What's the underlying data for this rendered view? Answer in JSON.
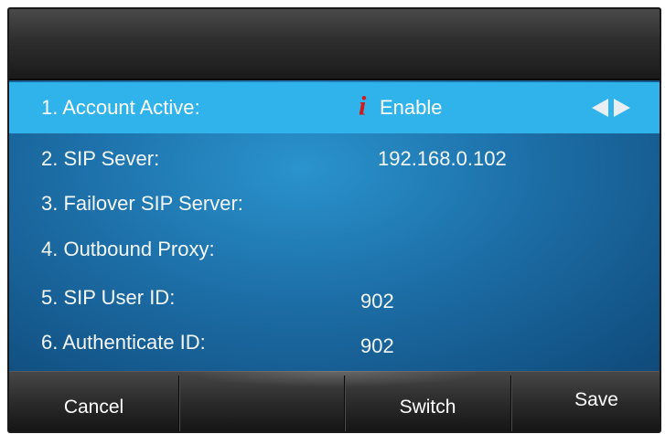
{
  "settings": {
    "rows": [
      {
        "label": "1. Account Active:",
        "value": "Enable",
        "info_icon": "i",
        "arrows_icon": "left-right-arrows-icon"
      },
      {
        "label": "2. SIP Sever:",
        "value": "192.168.0.102"
      },
      {
        "label": "3. Failover SIP Server:",
        "value": ""
      },
      {
        "label": "4. Outbound Proxy:",
        "value": ""
      },
      {
        "label": "5. SIP User ID:",
        "value": "902"
      },
      {
        "label": "6. Authenticate ID:",
        "value": "902"
      }
    ]
  },
  "softkeys": {
    "cancel": "Cancel",
    "blank": "",
    "switch": "Switch",
    "save": "Save"
  },
  "colors": {
    "selected_row": "#2fb3ea",
    "list_background": "#1d6fa8",
    "info_icon": "#d11a1a",
    "title_bar": "#2e2e2e"
  }
}
